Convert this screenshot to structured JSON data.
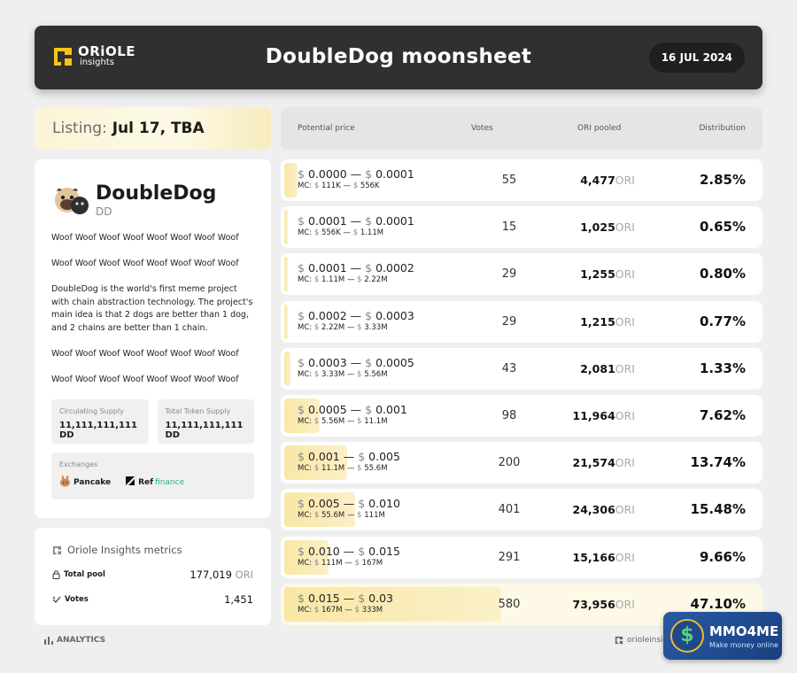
{
  "header": {
    "logo_name": "ORiOLE",
    "logo_sub": "insights",
    "title": "DoubleDog moonsheet",
    "date": "16 JUL 2024"
  },
  "listing": {
    "label": "Listing:",
    "value": "Jul 17, TBA"
  },
  "project": {
    "name": "DoubleDog",
    "ticker": "DD",
    "paragraphs": [
      "Woof Woof Woof Woof Woof Woof Woof Woof",
      "Woof Woof Woof Woof Woof Woof Woof Woof",
      "DoubleDog is the world's first meme project with chain abstraction technology. The project's main idea is that 2 dogs are better than 1 dog, and 2 chains are better than 1 chain.",
      "Woof Woof Woof Woof Woof Woof Woof Woof",
      "Woof Woof Woof Woof Woof Woof Woof Woof"
    ],
    "circulating_label": "Circulating Supply",
    "circulating_value": "11,111,111,111 DD",
    "total_label": "Total Token Supply",
    "total_value": "11,111,111,111 DD",
    "exchanges_label": "Exchanges",
    "exchanges": [
      "Pancake",
      "Ref",
      "finance"
    ]
  },
  "metrics": {
    "title": "Oriole Insights metrics",
    "pool_label": "Total pool",
    "pool_value": "177,019",
    "pool_unit": "ORI",
    "votes_label": "Votes",
    "votes_value": "1,451"
  },
  "footer": {
    "left": "ANALYTICS",
    "right": "orioleinsights"
  },
  "table": {
    "headers": [
      "Potential price",
      "Votes",
      "ORI pooled",
      "Distribution"
    ],
    "currency": "$",
    "mc_label": "MC:",
    "dash": "—",
    "unit": "ORI",
    "rows": [
      {
        "p_from": "0.0000",
        "p_to": "0.0001",
        "mc_from": "111K",
        "mc_to": "556K",
        "votes": "55",
        "pooled": "4,477",
        "dist": "2.85%",
        "share": 0.0285
      },
      {
        "p_from": "0.0001",
        "p_to": "0.0001",
        "mc_from": "556K",
        "mc_to": "1.11M",
        "votes": "15",
        "pooled": "1,025",
        "dist": "0.65%",
        "share": 0.0065
      },
      {
        "p_from": "0.0001",
        "p_to": "0.0002",
        "mc_from": "1.11M",
        "mc_to": "2.22M",
        "votes": "29",
        "pooled": "1,255",
        "dist": "0.80%",
        "share": 0.008
      },
      {
        "p_from": "0.0002",
        "p_to": "0.0003",
        "mc_from": "2.22M",
        "mc_to": "3.33M",
        "votes": "29",
        "pooled": "1,215",
        "dist": "0.77%",
        "share": 0.0077
      },
      {
        "p_from": "0.0003",
        "p_to": "0.0005",
        "mc_from": "3.33M",
        "mc_to": "5.56M",
        "votes": "43",
        "pooled": "2,081",
        "dist": "1.33%",
        "share": 0.0133
      },
      {
        "p_from": "0.0005",
        "p_to": "0.001",
        "mc_from": "5.56M",
        "mc_to": "11.1M",
        "votes": "98",
        "pooled": "11,964",
        "dist": "7.62%",
        "share": 0.0762
      },
      {
        "p_from": "0.001",
        "p_to": "0.005",
        "mc_from": "11.1M",
        "mc_to": "55.6M",
        "votes": "200",
        "pooled": "21,574",
        "dist": "13.74%",
        "share": 0.1374
      },
      {
        "p_from": "0.005",
        "p_to": "0.010",
        "mc_from": "55.6M",
        "mc_to": "111M",
        "votes": "401",
        "pooled": "24,306",
        "dist": "15.48%",
        "share": 0.1548
      },
      {
        "p_from": "0.010",
        "p_to": "0.015",
        "mc_from": "111M",
        "mc_to": "167M",
        "votes": "291",
        "pooled": "15,166",
        "dist": "9.66%",
        "share": 0.0966
      },
      {
        "p_from": "0.015",
        "p_to": "0.03",
        "mc_from": "167M",
        "mc_to": "333M",
        "votes": "580",
        "pooled": "73,956",
        "dist": "47.10%",
        "share": 0.471,
        "highlight": true
      }
    ]
  },
  "badge": {
    "title": "MMO4ME",
    "subtitle": "Make money online"
  },
  "colors": {
    "header_bg": "#303030",
    "accent_yellow": "#f9e7a5",
    "logo_yellow": "#f5c518"
  }
}
